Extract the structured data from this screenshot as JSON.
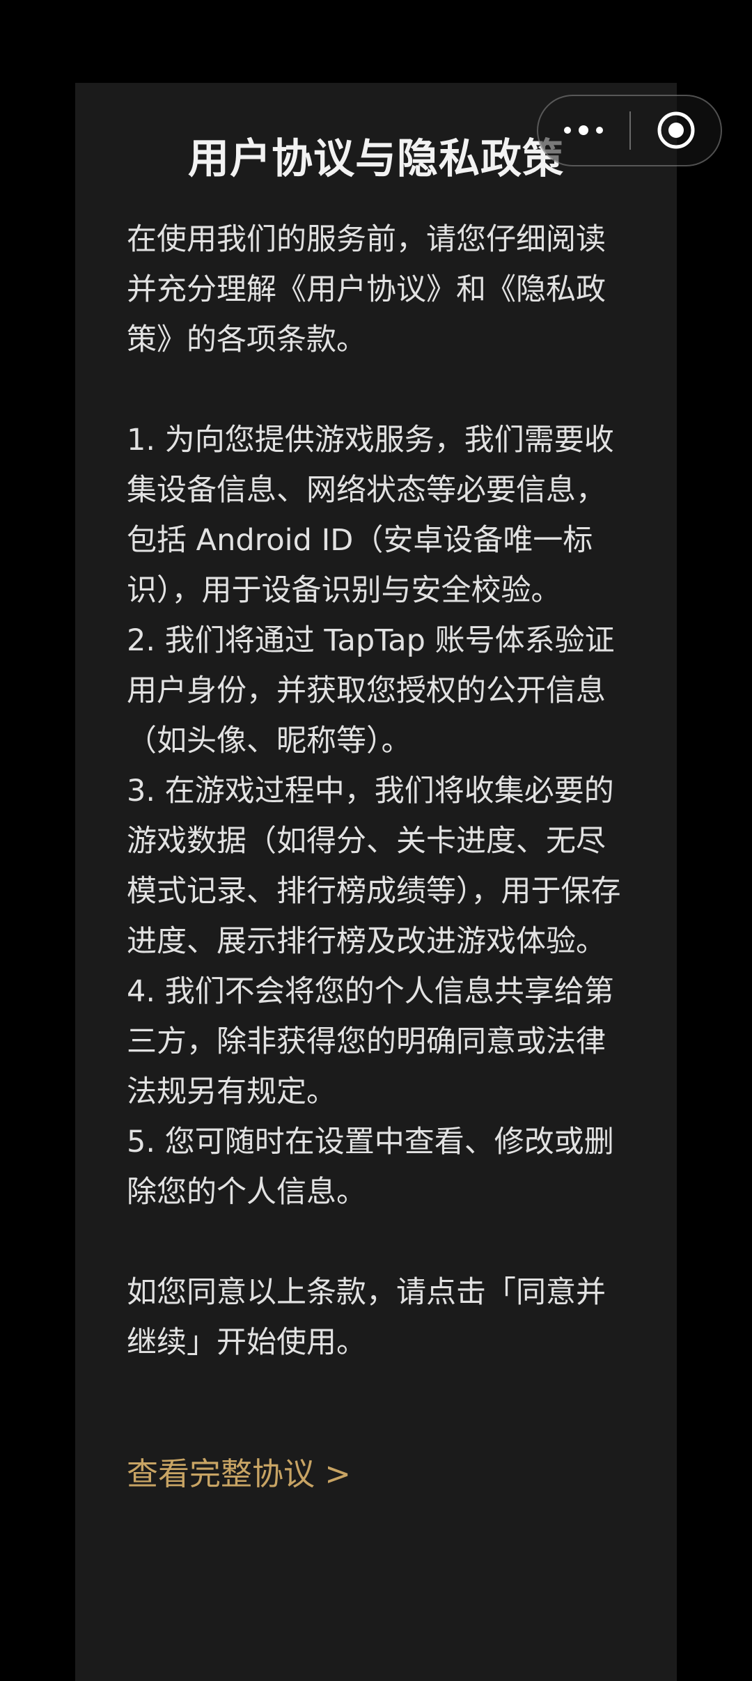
{
  "dialog": {
    "title": "用户协议与隐私政策",
    "paragraphs": {
      "intro": "在使用我们的服务前，请您仔细阅读并充分理解《用户协议》和《隐私政策》的各项条款。",
      "item1": "1. 为向您提供游戏服务，我们需要收集设备信息、网络状态等必要信息，包括 Android ID（安卓设备唯一标识），用于设备识别与安全校验。",
      "item2": "2. 我们将通过 TapTap 账号体系验证用户身份，并获取您授权的公开信息（如头像、昵称等）。",
      "item3": "3. 在游戏过程中，我们将收集必要的游戏数据（如得分、关卡进度、无尽模式记录、排行榜成绩等），用于保存进度、展示排行榜及改进游戏体验。",
      "item4": "4. 我们不会将您的个人信息共享给第三方，除非获得您的明确同意或法律法规另有规定。",
      "item5": "5. 您可随时在设置中查看、修改或删除您的个人信息。",
      "consent": "如您同意以上条款，请点击「同意并继续」开始使用。"
    },
    "view_full_link": "查看完整协议 >"
  },
  "capsule": {
    "more_icon": "more-dots-icon",
    "close_icon": "target-close-icon"
  },
  "colors": {
    "background": "#000000",
    "modal": "#1b1b1b",
    "text": "#e2e2e2",
    "link": "#c8a464"
  }
}
